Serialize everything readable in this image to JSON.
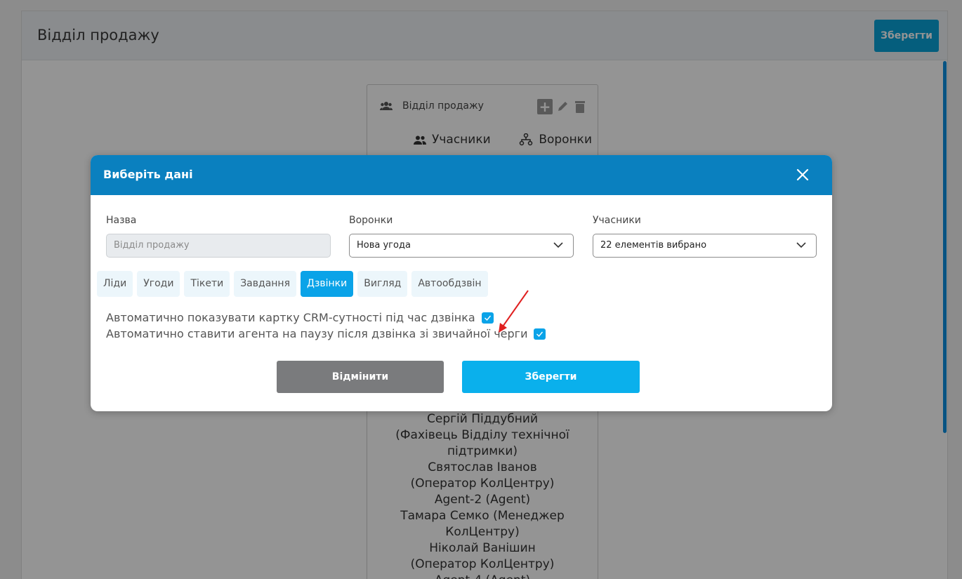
{
  "background": {
    "panel_title": "Відділ продажу",
    "save_label": "Зберегти",
    "card": {
      "title": "Відділ продажу",
      "members_link": "Учасники",
      "funnels_link": "Воронки",
      "members": [
        "Сергій Піддубний",
        "(Фахівець Відділу технічної",
        "підтримки)",
        "Святослав Іванов",
        "(Оператор КолЦентру)",
        "Agent-2 (Agent)",
        "Тамара Семко (Менеджер",
        "КолЦентру)",
        "Ніколай Ванішин",
        "(Оператор КолЦентру)",
        "Agent-4 (Agent)"
      ]
    }
  },
  "modal": {
    "title": "Виберіть дані",
    "name_label": "Назва",
    "name_value": "Відділ продажу",
    "funnels_label": "Воронки",
    "funnels_value": "Нова угода",
    "members_label": "Учасники",
    "members_value": "22 елементів вибрано",
    "tabs": [
      "Ліди",
      "Угоди",
      "Тікети",
      "Завдання",
      "Дзвінки",
      "Вигляд",
      "Автообдзвін"
    ],
    "active_tab": "Дзвінки",
    "option_1": "Автоматично показувати картку CRM-сутності під час дзвінка",
    "option_1_checked": true,
    "option_2": "Автоматично ставити агента на паузу після дзвінка зі звичайної черги",
    "option_2_checked": true,
    "cancel_label": "Відмінити",
    "save_label": "Зберегти"
  },
  "colors": {
    "header": "#0a80bf",
    "accent": "#0aa3e8",
    "cancel": "#7a7b7d",
    "arrow": "#e02020"
  }
}
